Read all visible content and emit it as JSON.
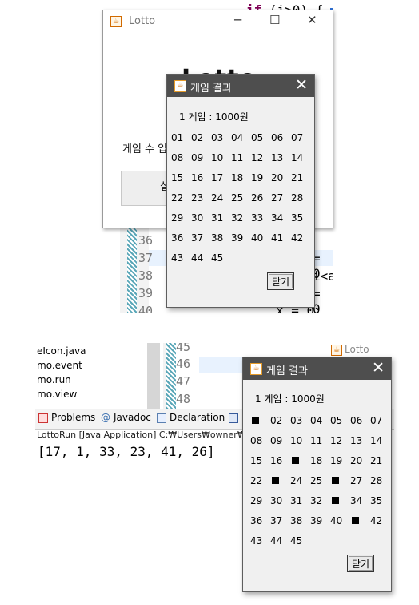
{
  "top": {
    "editor": {
      "code_top": "if (i>0) {",
      "line_numbers": [
        "36",
        "37",
        "38",
        "39",
        "40"
      ],
      "code_37": "= 0",
      "code_38": "i<a",
      "code_39": "= 0",
      "code_40": "x = 0;"
    },
    "main_window": {
      "title": "Lotto",
      "big_text": "Lotto",
      "games_label": "게임 수 입",
      "run_button": "실행"
    },
    "dialog": {
      "title": "게임 결과",
      "info": "1 게임 : 1000원",
      "numbers": [
        "01",
        "02",
        "03",
        "04",
        "05",
        "06",
        "07",
        "08",
        "09",
        "10",
        "11",
        "12",
        "13",
        "14",
        "15",
        "16",
        "17",
        "18",
        "19",
        "20",
        "21",
        "22",
        "23",
        "24",
        "25",
        "26",
        "27",
        "28",
        "29",
        "30",
        "31",
        "32",
        "33",
        "34",
        "35",
        "36",
        "37",
        "38",
        "39",
        "40",
        "41",
        "42",
        "43",
        "44",
        "45"
      ],
      "close_button": "닫기"
    }
  },
  "bottom": {
    "tree_items": [
      "eIcon.java",
      "mo.event",
      "mo.run",
      "mo.view"
    ],
    "line_numbers": [
      "45",
      "46",
      "47",
      "48"
    ],
    "tabs": [
      "Problems",
      "Javadoc",
      "Declaration"
    ],
    "console_title": "LottoRun [Java Application] C:₩Users₩owner₩y",
    "console_output": "[17, 1, 33, 23, 41, 26]",
    "background_window_title": "Lotto",
    "dialog": {
      "title": "게임 결과",
      "info": "1 게임 : 1000원",
      "numbers": [
        "■",
        "02",
        "03",
        "04",
        "05",
        "06",
        "07",
        "08",
        "09",
        "10",
        "11",
        "12",
        "13",
        "14",
        "15",
        "16",
        "■",
        "18",
        "19",
        "20",
        "21",
        "22",
        "■",
        "24",
        "25",
        "■",
        "27",
        "28",
        "29",
        "30",
        "31",
        "32",
        "■",
        "34",
        "35",
        "36",
        "37",
        "38",
        "39",
        "40",
        "■",
        "42",
        "43",
        "44",
        "45"
      ],
      "close_button": "닫기"
    }
  }
}
